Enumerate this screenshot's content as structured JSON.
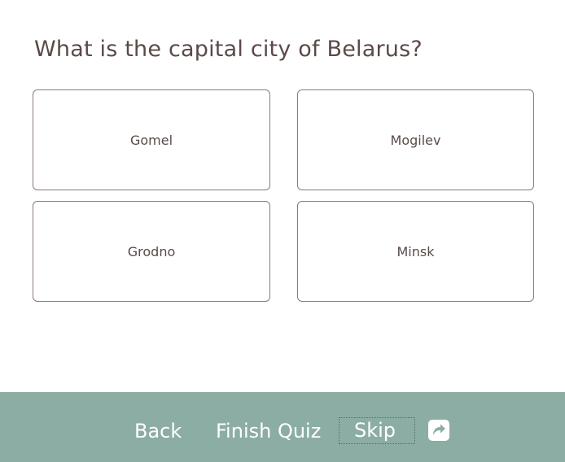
{
  "quiz": {
    "question": "What is the capital city of Belarus?",
    "options": [
      {
        "label": "Gomel"
      },
      {
        "label": "Mogilev"
      },
      {
        "label": "Grodno"
      },
      {
        "label": "Minsk"
      }
    ]
  },
  "footer": {
    "back_label": "Back",
    "finish_label": "Finish Quiz",
    "skip_label": "Skip",
    "share_icon": "share-icon"
  },
  "colors": {
    "footer_bg": "#8cada4",
    "text": "#5a4a48",
    "footer_text": "#ffffff"
  }
}
